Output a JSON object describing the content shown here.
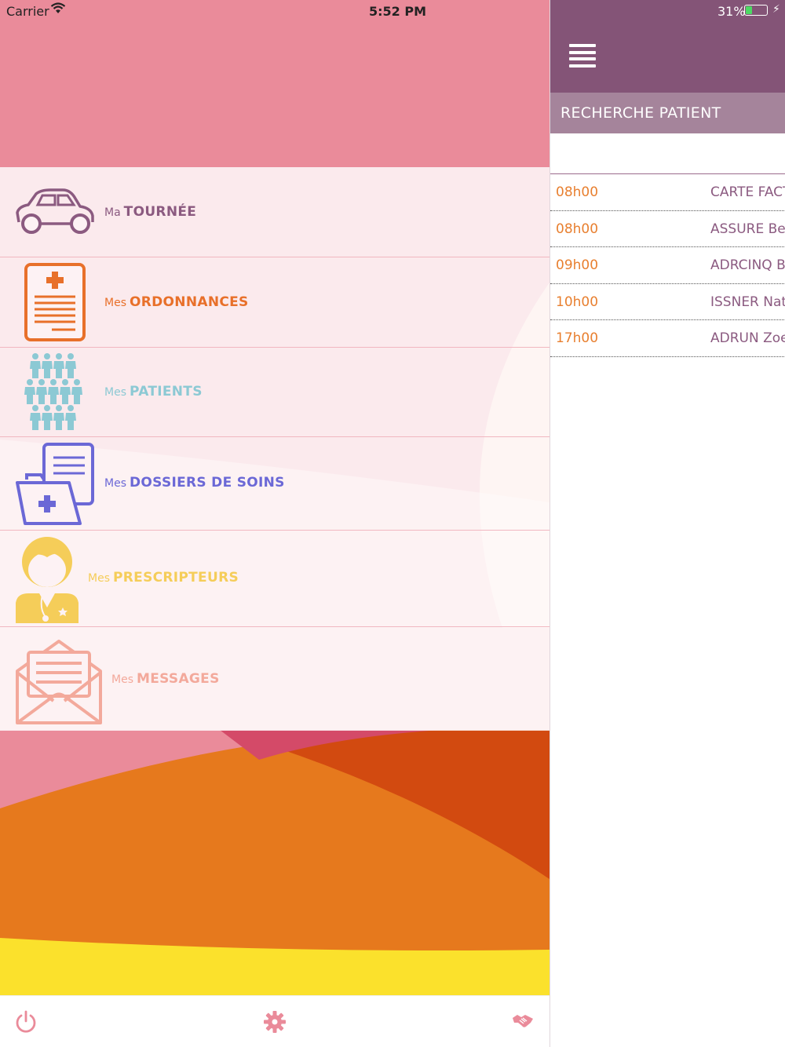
{
  "status_bar": {
    "carrier": "Carrier",
    "time": "5:52 PM",
    "battery": "31%",
    "battery_level": 0.31
  },
  "menu": {
    "items": [
      {
        "id": "tournee",
        "prefix": "Ma",
        "label": "TOURNÉE",
        "color": "#8b5a80",
        "icon": "car-icon"
      },
      {
        "id": "ordonnances",
        "prefix": "Mes",
        "label": "ORDONNANCES",
        "color": "#e8702a",
        "icon": "prescription-icon"
      },
      {
        "id": "patients",
        "prefix": "Mes",
        "label": "PATIENTS",
        "color": "#8cc9d4",
        "icon": "people-icon"
      },
      {
        "id": "dossiers",
        "prefix": "Mes",
        "label": "DOSSIERS DE SOINS",
        "color": "#6b68d6",
        "icon": "folder-icon"
      },
      {
        "id": "prescripteurs",
        "prefix": "Mes",
        "label": "PRESCRIPTEURS",
        "color": "#f5cd59",
        "icon": "doctor-icon"
      },
      {
        "id": "messages",
        "prefix": "Mes",
        "label": "MESSAGES",
        "color": "#f3a99b",
        "icon": "envelope-icon"
      }
    ]
  },
  "bottom_bar": {
    "icons": [
      "power-icon",
      "gear-icon",
      "handshake-icon"
    ],
    "color": "#ea8b9a"
  },
  "right_panel": {
    "search_title": "RECHERCHE PATIENT",
    "search_value": "",
    "appointments": [
      {
        "time": "08h00",
        "name": "CARTE FACT"
      },
      {
        "time": "08h00",
        "name": "ASSURE Be"
      },
      {
        "time": "09h00",
        "name": "ADRCINQ B"
      },
      {
        "time": "10h00",
        "name": "ISSNER Nat"
      },
      {
        "time": "17h00",
        "name": "ADRUN Zoe"
      }
    ]
  },
  "colors": {
    "header_purple": "#845477",
    "search_purple": "#a5849b",
    "time_orange": "#e87f2f",
    "name_purple": "#8b5a80",
    "pink": "#ea8b9a"
  }
}
